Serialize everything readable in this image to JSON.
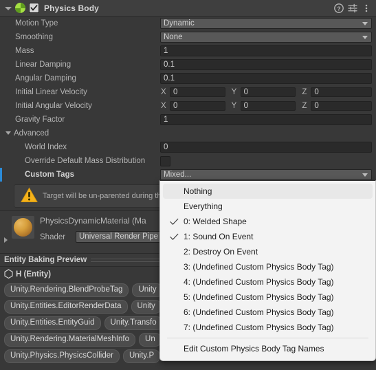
{
  "header": {
    "title": "Physics Body",
    "enabled_checkbox": true,
    "icon": "physics-body-icon",
    "buttons": [
      {
        "name": "help-icon",
        "glyph": "?"
      },
      {
        "name": "preset-icon",
        "glyph": "preset"
      },
      {
        "name": "more-menu-icon",
        "glyph": "⋮"
      }
    ]
  },
  "properties": [
    {
      "label": "Motion Type",
      "type": "popup",
      "value": "Dynamic"
    },
    {
      "label": "Smoothing",
      "type": "popup",
      "value": "None"
    },
    {
      "label": "Mass",
      "type": "text",
      "value": "1"
    },
    {
      "label": "Linear Damping",
      "type": "text",
      "value": "0.1"
    },
    {
      "label": "Angular Damping",
      "type": "text",
      "value": "0.1"
    },
    {
      "label": "Initial Linear Velocity",
      "type": "vector3",
      "x": "0",
      "y": "0",
      "z": "0"
    },
    {
      "label": "Initial Angular Velocity",
      "type": "vector3",
      "x": "0",
      "y": "0",
      "z": "0"
    },
    {
      "label": "Gravity Factor",
      "type": "text",
      "value": "1"
    }
  ],
  "advanced": {
    "label": "Advanced",
    "expanded": true,
    "properties": [
      {
        "label": "World Index",
        "type": "text",
        "value": "0"
      },
      {
        "label": "Override Default Mass Distribution",
        "type": "checkbox",
        "checked": false
      },
      {
        "label": "Custom Tags",
        "type": "popup",
        "value": "Mixed...",
        "bold": true,
        "accent": true
      }
    ]
  },
  "axes": {
    "x": "X",
    "y": "Y",
    "z": "Z"
  },
  "warning": {
    "icon": "warning-icon",
    "text": "Target will be un-parented during the"
  },
  "material": {
    "name": "PhysicsDynamicMaterial (Ma",
    "shader_label": "Shader",
    "shader_value": "Universal Render Pipe"
  },
  "entity_baking_preview": {
    "title": "Entity Baking Preview",
    "entity_label": "H (Entity)",
    "component_tags": [
      [
        "Unity.Rendering.BlendProbeTag",
        "Unity"
      ],
      [
        "Unity.Entities.EditorRenderData",
        "Unity"
      ],
      [
        "Unity.Entities.EntityGuid",
        "Unity.Transfo"
      ],
      [
        "Unity.Rendering.MaterialMeshInfo",
        "Un"
      ],
      [
        "Unity.Physics.PhysicsCollider",
        "Unity.P"
      ]
    ]
  },
  "dropdown_menu": {
    "items": [
      {
        "label": "Nothing",
        "checked": false,
        "hover": true
      },
      {
        "label": "Everything",
        "checked": false,
        "hover": false
      },
      {
        "label": "0: Welded Shape",
        "checked": true,
        "hover": false
      },
      {
        "label": "1: Sound On Event",
        "checked": true,
        "hover": false
      },
      {
        "label": "2: Destroy On Event",
        "checked": false,
        "hover": false
      },
      {
        "label": "3: (Undefined Custom Physics Body Tag)",
        "checked": false,
        "hover": false
      },
      {
        "label": "4: (Undefined Custom Physics Body Tag)",
        "checked": false,
        "hover": false
      },
      {
        "label": "5: (Undefined Custom Physics Body Tag)",
        "checked": false,
        "hover": false
      },
      {
        "label": "6: (Undefined Custom Physics Body Tag)",
        "checked": false,
        "hover": false
      },
      {
        "label": "7: (Undefined Custom Physics Body Tag)",
        "checked": false,
        "hover": false
      }
    ],
    "footer_item": "Edit Custom Physics Body Tag Names"
  },
  "colors": {
    "background": "#383838",
    "header_bg": "#3f3f3f",
    "accent_blue": "#2b8bd8",
    "component_icon_green": "#a5e043",
    "warning_yellow": "#f5b21a",
    "menu_bg": "#f3f3f3"
  }
}
